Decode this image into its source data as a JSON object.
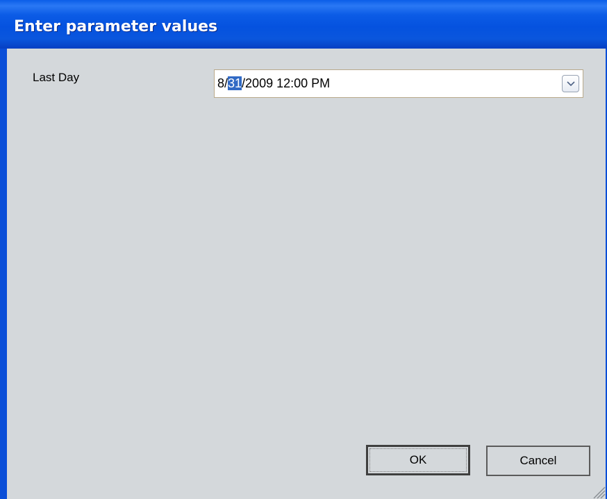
{
  "dialog": {
    "title": "Enter parameter values"
  },
  "parameters": [
    {
      "label": "Last Day",
      "value_prefix": "8/",
      "value_selected": "31",
      "value_suffix": "/2009 12:00 PM"
    }
  ],
  "buttons": {
    "ok_label": "OK",
    "cancel_label": "Cancel"
  },
  "icons": {
    "dropdown": "chevron-down-icon",
    "grip": "resize-grip-icon"
  },
  "colors": {
    "titlebar": "#0a56dd",
    "client_bg": "#d4d8db",
    "selection": "#316ac5"
  }
}
